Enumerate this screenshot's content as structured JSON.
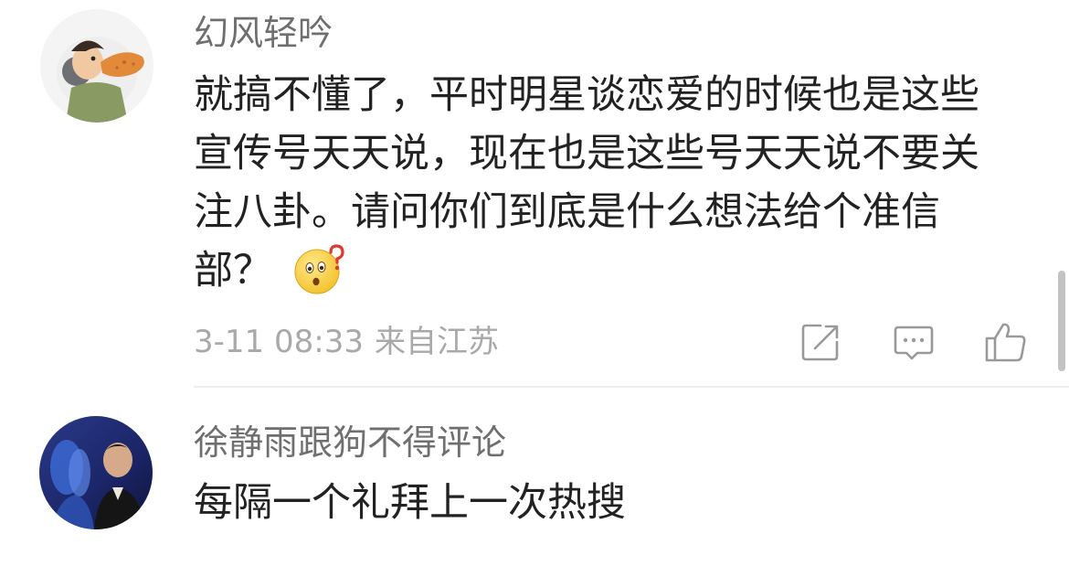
{
  "comments": [
    {
      "username": "幻风轻吟",
      "text_lines": [
        "就搞不懂了，平时明星谈恋爱的时候也是这些",
        "宣传号天天说，现在也是这些号天天说不要关",
        "注八卦。请问你们到底是什么想法给个准信",
        "部？"
      ],
      "emoji": "thinking-question-emoji",
      "time": "3-11 08:33",
      "location": "来自江苏",
      "actions": [
        "share-icon",
        "comment-icon",
        "like-icon"
      ]
    },
    {
      "username": "徐静雨跟狗不得评论",
      "text_lines": [
        "每隔一个礼拜上一次热搜"
      ]
    }
  ],
  "colors": {
    "username": "#6f6f6f",
    "text": "#222222",
    "meta": "#a9a9a9",
    "icon": "#999999",
    "divider": "#ededed"
  }
}
